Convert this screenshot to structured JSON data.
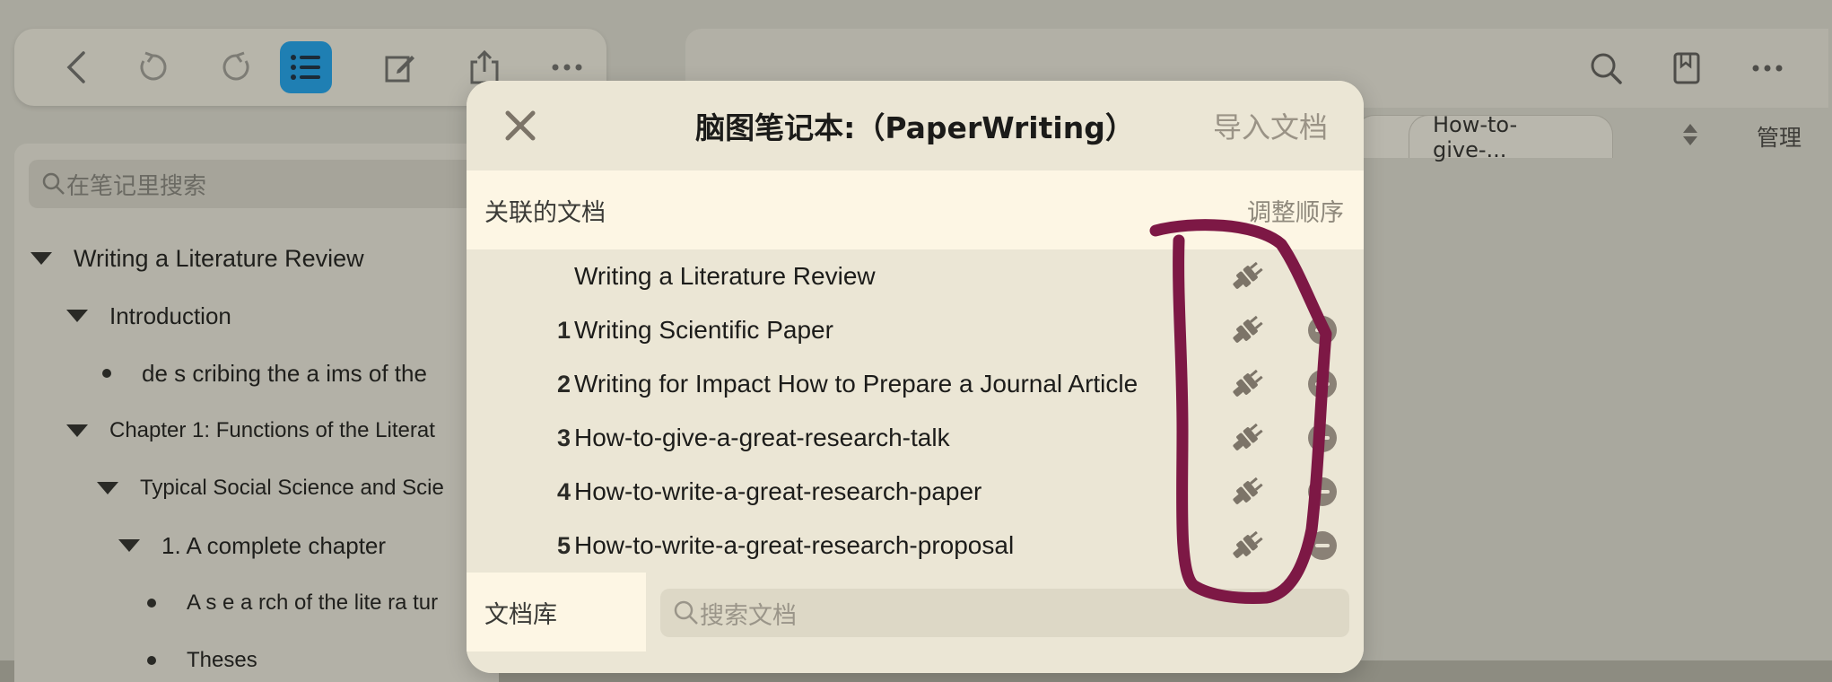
{
  "background": {
    "toolbar_left": [
      "back-icon",
      "undo-icon",
      "redo-icon",
      "outline-list-icon",
      "edit-icon",
      "share-icon",
      "more-icon"
    ],
    "toolbar_right": [
      "search-icon",
      "bookmark-icon",
      "more-icon"
    ],
    "outline": {
      "search_placeholder": "在笔记里搜索",
      "items": [
        "Writing a Literature Review",
        "Introduction",
        "de s cribing the  a ims of the",
        "Chapter 1: Functions of the Literat",
        "Typical Social Science and Scie",
        "1. A complete chapter",
        "A s e a rch of the  lite ra tur",
        "Theses"
      ]
    },
    "tabs": [
      "...",
      "How-to-give-..."
    ],
    "tab_manage": "管理"
  },
  "modal": {
    "title": "脑图笔记本:（PaperWriting）",
    "import_label": "导入文档",
    "linked_section": {
      "label": "关联的文档",
      "reorder_label": "调整顺序"
    },
    "documents": [
      {
        "num": "",
        "title": "Writing a Literature Review",
        "removable": false
      },
      {
        "num": "1",
        "title": "Writing Scientific Paper",
        "removable": true
      },
      {
        "num": "2",
        "title": "Writing for Impact How to Prepare a Journal Article",
        "removable": true
      },
      {
        "num": "3",
        "title": "How-to-give-a-great-research-talk",
        "removable": true
      },
      {
        "num": "4",
        "title": "How-to-write-a-great-research-paper",
        "removable": true
      },
      {
        "num": "5",
        "title": "How-to-write-a-great-research-proposal",
        "removable": true
      }
    ],
    "library": {
      "label": "文档库",
      "search_placeholder": "搜索文档"
    }
  },
  "colors": {
    "accent_blue": "#1f7fb3",
    "annotation_ink": "#7d1845",
    "modal_bg": "#ebe6d5",
    "section_bg": "#fdf6e4"
  }
}
